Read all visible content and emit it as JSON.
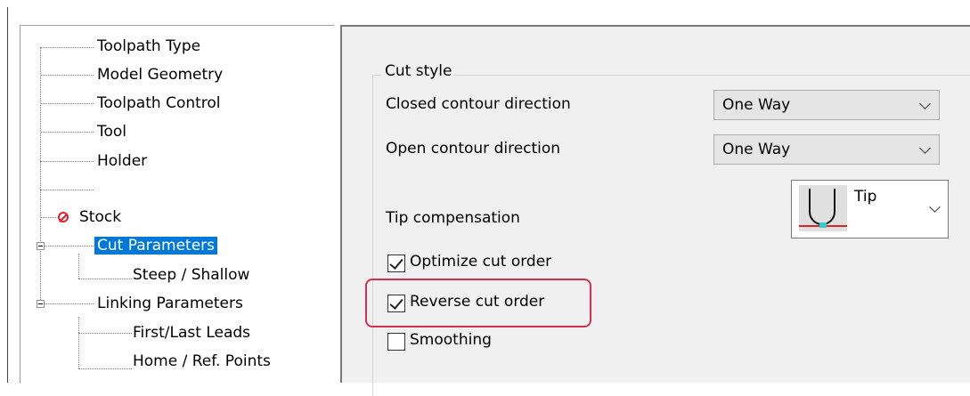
{
  "tree": {
    "items": [
      {
        "label": "Toolpath Type"
      },
      {
        "label": "Model Geometry"
      },
      {
        "label": "Toolpath Control"
      },
      {
        "label": "Tool"
      },
      {
        "label": "Holder"
      },
      {
        "label": ""
      },
      {
        "label": "Stock"
      },
      {
        "label": "Cut Parameters"
      },
      {
        "label": "Steep / Shallow"
      },
      {
        "label": "Linking Parameters"
      },
      {
        "label": "First/Last Leads"
      },
      {
        "label": "Home / Ref. Points"
      }
    ],
    "selected": "Cut Parameters"
  },
  "cut_style": {
    "group_title": "Cut style",
    "closed_contour_label": "Closed contour direction",
    "closed_contour_value": "One Way",
    "open_contour_label": "Open contour direction",
    "open_contour_value": "One Way",
    "tip_compensation_label": "Tip compensation",
    "tip_compensation_value": "Tip",
    "optimize_cut_order": {
      "label": "Optimize cut order",
      "checked": true
    },
    "reverse_cut_order": {
      "label": "Reverse cut order",
      "checked": true
    },
    "smoothing": {
      "label": "Smoothing",
      "checked": false
    }
  },
  "colors": {
    "selection": "#0078d7",
    "highlight": "#d3304f",
    "stock_icon": "#e0202a"
  }
}
